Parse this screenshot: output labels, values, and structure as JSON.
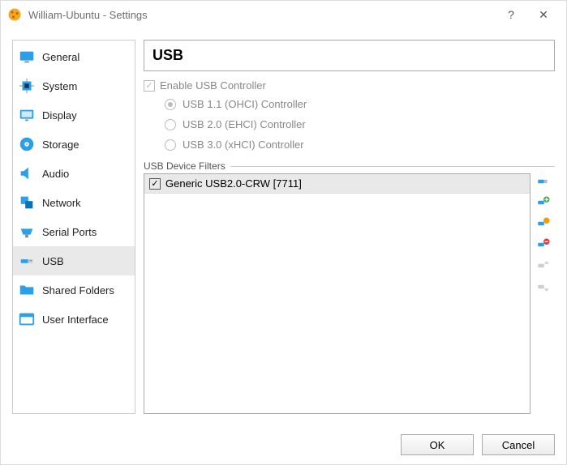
{
  "title": "William-Ubuntu - Settings",
  "sidebar": {
    "items": [
      {
        "label": "General"
      },
      {
        "label": "System"
      },
      {
        "label": "Display"
      },
      {
        "label": "Storage"
      },
      {
        "label": "Audio"
      },
      {
        "label": "Network"
      },
      {
        "label": "Serial Ports"
      },
      {
        "label": "USB"
      },
      {
        "label": "Shared Folders"
      },
      {
        "label": "User Interface"
      }
    ]
  },
  "main": {
    "heading": "USB",
    "enable_label": "Enable USB Controller",
    "enable_checked": true,
    "controllers": [
      {
        "label": "USB 1.1 (OHCI) Controller",
        "selected": true
      },
      {
        "label": "USB 2.0 (EHCI) Controller",
        "selected": false
      },
      {
        "label": "USB 3.0 (xHCI) Controller",
        "selected": false
      }
    ],
    "filters_label": "USB Device Filters",
    "filters": [
      {
        "label": "Generic USB2.0-CRW [7711]",
        "checked": true
      }
    ]
  },
  "buttons": {
    "ok": "OK",
    "cancel": "Cancel"
  }
}
